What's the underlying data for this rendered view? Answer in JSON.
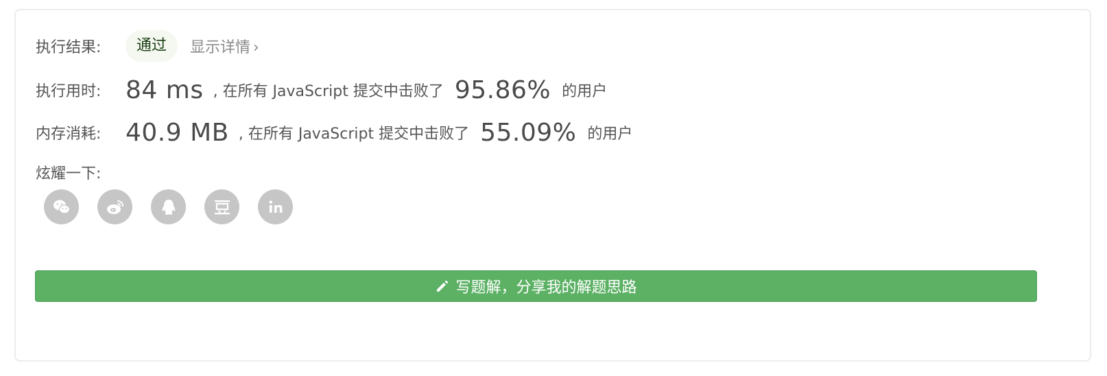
{
  "result": {
    "label": "执行结果:",
    "status": "通过",
    "details_link": "显示详情",
    "chevron": "›"
  },
  "runtime": {
    "label": "执行用时:",
    "value": "84 ms",
    "middle_text": ", 在所有 JavaScript 提交中击败了",
    "percent": "95.86%",
    "tail": "的用户"
  },
  "memory": {
    "label": "内存消耗:",
    "value": "40.9 MB",
    "middle_text": ", 在所有 JavaScript 提交中击败了",
    "percent": "55.09%",
    "tail": "的用户"
  },
  "share": {
    "label": "炫耀一下:",
    "icons": [
      "wechat-icon",
      "weibo-icon",
      "qq-icon",
      "douban-icon",
      "linkedin-icon"
    ],
    "icon_color": "#c6c6c6"
  },
  "action_button": {
    "label": "写题解，分享我的解题思路",
    "icon": "pencil-icon",
    "color": "#5cb165"
  }
}
